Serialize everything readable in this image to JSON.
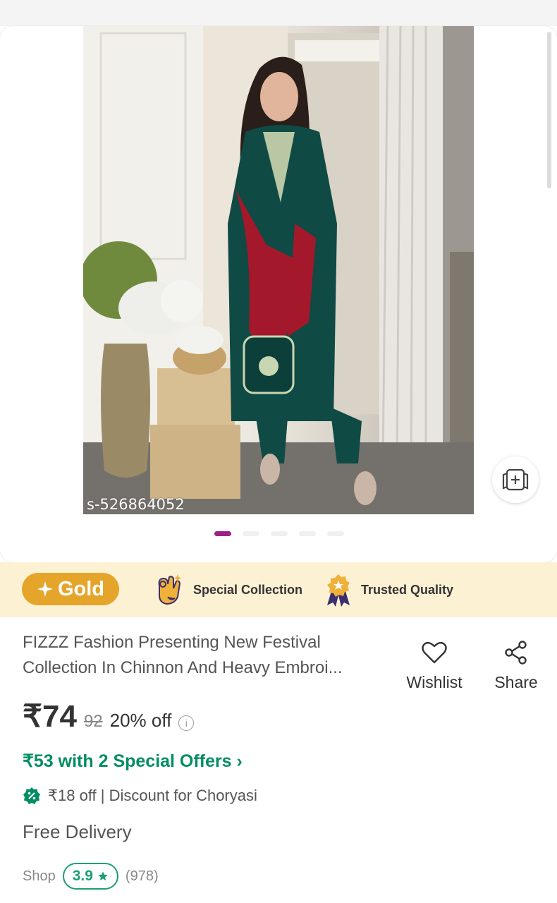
{
  "product_image": {
    "sku_label": "s-526864052",
    "carousel": {
      "count": 5,
      "active_index": 0
    }
  },
  "banner": {
    "gold_label": "Gold",
    "features": [
      {
        "icon": "ok-hand-icon",
        "label": "Special Collection"
      },
      {
        "icon": "quality-badge-icon",
        "label": "Trusted Quality"
      }
    ]
  },
  "product": {
    "title_line1": "FIZZZ Fashion Presenting New Festival",
    "title_line2": "Collection In Chinnon And Heavy Embroi...",
    "wishlist_label": "Wishlist",
    "share_label": "Share",
    "price": "₹74",
    "mrp": "92",
    "discount": "20% off",
    "special_offers": "₹53 with 2 Special Offers",
    "offer_line": "₹18 off | Discount for Choryasi",
    "delivery": "Free Delivery",
    "shop_label": "Shop",
    "rating": "3.9",
    "review_count": "(978)"
  },
  "colors": {
    "accent": "#9f2089",
    "gold": "#e5a52a",
    "banner_bg": "#fdf1d4",
    "offer_green": "#038d63"
  }
}
